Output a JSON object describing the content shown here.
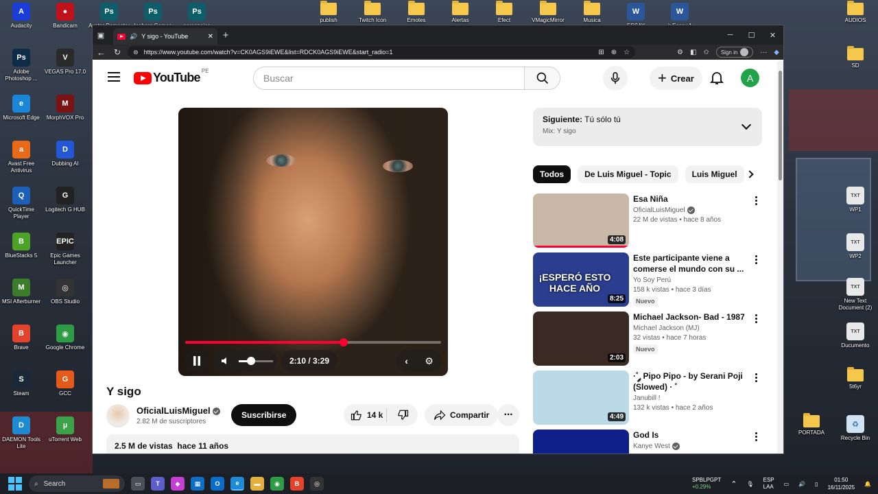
{
  "desktop": {
    "icons_left": [
      {
        "label": "Audacity",
        "color": "#1a3dd8",
        "glyph": "A"
      },
      {
        "label": "Bandicam",
        "color": "#c0121b",
        "glyph": "●"
      },
      {
        "label": "Avatar Remaster",
        "color": "#0d5e6a",
        "glyph": "Ps"
      },
      {
        "label": "Iceberg Games",
        "color": "#0d5e6a",
        "glyph": "Ps"
      },
      {
        "label": "personajes",
        "color": "#0d5e6a",
        "glyph": "Ps"
      },
      {
        "label": "Adobe Photoshop ...",
        "color": "#0e2b47",
        "glyph": "Ps"
      },
      {
        "label": "VEGAS Pro 17.0",
        "color": "#2a2a2a",
        "glyph": "V"
      },
      {
        "label": "Microsoft Edge",
        "color": "#1b86d6",
        "glyph": "e"
      },
      {
        "label": "MorphVOX Pro",
        "color": "#7a1414",
        "glyph": "M"
      },
      {
        "label": "Avast Free Antivirus",
        "color": "#e86a17",
        "glyph": "a"
      },
      {
        "label": "Dubbing AI",
        "color": "#2457d6",
        "glyph": "D"
      },
      {
        "label": "QuickTime Player",
        "color": "#1c5fb7",
        "glyph": "Q"
      },
      {
        "label": "Logitech G HUB",
        "color": "#222",
        "glyph": "G"
      },
      {
        "label": "BlueStacks 5",
        "color": "#4da327",
        "glyph": "B"
      },
      {
        "label": "Epic Games Launcher",
        "color": "#222",
        "glyph": "EPIC"
      },
      {
        "label": "MSI Afterburner",
        "color": "#3b7d2b",
        "glyph": "M"
      },
      {
        "label": "OBS Studio",
        "color": "#333",
        "glyph": "◎"
      },
      {
        "label": "Brave",
        "color": "#e2432a",
        "glyph": "B"
      },
      {
        "label": "Google Chrome",
        "color": "#2e9b45",
        "glyph": "◉"
      },
      {
        "label": "Steam",
        "color": "#1b2838",
        "glyph": "S"
      },
      {
        "label": "GCC",
        "color": "#e45a1a",
        "glyph": "G"
      },
      {
        "label": "DAEMON Tools Lite",
        "color": "#1d8bd1",
        "glyph": "D"
      },
      {
        "label": "uTorrent Web",
        "color": "#3aa34a",
        "glyph": "µ"
      }
    ],
    "icons_top": [
      {
        "label": "publish",
        "type": "folder"
      },
      {
        "label": "Twitch Icon",
        "type": "folder"
      },
      {
        "label": "Emotes",
        "type": "folder"
      },
      {
        "label": "Alertas",
        "type": "folder"
      },
      {
        "label": "Efect",
        "type": "folder"
      },
      {
        "label": "VMagicMirror",
        "type": "folder"
      },
      {
        "label": "Musica",
        "type": "folder"
      },
      {
        "label": "ESSAY",
        "type": "word"
      },
      {
        "label": "jr Essay 1",
        "type": "word"
      },
      {
        "label": "AUDIOS",
        "type": "folder"
      }
    ],
    "icons_right": [
      {
        "label": "SD",
        "type": "folder"
      },
      {
        "label": "WP1",
        "type": "txt"
      },
      {
        "label": "WP2",
        "type": "txt"
      },
      {
        "label": "New Text Document (2)",
        "type": "txt"
      },
      {
        "label": "Ducumento",
        "type": "txt"
      },
      {
        "label": "5t6yr",
        "type": "folder"
      },
      {
        "label": "PORTADA",
        "type": "folder"
      },
      {
        "label": "Recycle Bin",
        "type": "bin"
      }
    ]
  },
  "browser": {
    "tab_title": "Y sigo - YouTube",
    "url": "https://www.youtube.com/watch?v=CK0AGS9iEWE&list=RDCK0AGS9iEWE&start_radio=1",
    "signin_label": "Sign in"
  },
  "youtube": {
    "logo_word": "YouTube",
    "country_code": "PE",
    "search_placeholder": "Buscar",
    "create_label": "Crear",
    "avatar_letter": "A",
    "player": {
      "current_time": "2:10",
      "duration": "3:29",
      "time_display": "2:10 / 3:29",
      "progress_fraction": 0.62,
      "volume_fraction": 0.35
    },
    "video_title": "Y sigo",
    "channel": {
      "name": "OficialLuisMiguel",
      "subscribers": "2.82 M de suscriptores"
    },
    "subscribe_label": "Suscribirse",
    "likes": "14 k",
    "share_label": "Compartir",
    "description_summary": "2.5 M de vistas  hace 11 años",
    "up_next": {
      "prefix": "Siguiente:",
      "title": "Tú sólo tú",
      "subtitle": "Mix: Y sigo"
    },
    "chips": [
      "Todos",
      "De Luis Miguel - Topic",
      "Luis Miguel"
    ],
    "recommendations": [
      {
        "title": "Esa Niña",
        "channel": "OficialLuisMiguel",
        "verified": true,
        "meta": "22 M de vistas • hace 8 años",
        "duration": "4:08",
        "badge": "",
        "watched_fraction": 1.0,
        "thumb": "#c9b8a8"
      },
      {
        "title": "Este participante viene a comerse el mundo con su ...",
        "channel": "Yo Soy Perú",
        "verified": false,
        "meta": "158 k vistas • hace 3 días",
        "duration": "8:25",
        "badge": "Nuevo",
        "watched_fraction": 0,
        "thumb": "#2a3d8f"
      },
      {
        "title": "Michael Jackson- Bad - 1987",
        "channel": "Michael Jackson (MJ)",
        "verified": false,
        "meta": "32 vistas • hace 7 horas",
        "duration": "2:03",
        "badge": "Nuevo",
        "watched_fraction": 0,
        "thumb": "#3a2a24"
      },
      {
        "title": "·˚ ༘ Pipo Pipo - by Serani Poji (Slowed) · ˚",
        "channel": "Janubill !",
        "verified": false,
        "meta": "132 k vistas • hace 2 años",
        "duration": "4:49",
        "badge": "",
        "watched_fraction": 0,
        "thumb": "#bcd9e8"
      },
      {
        "title": "God Is",
        "channel": "Kanye West",
        "verified": true,
        "meta": "",
        "duration": "",
        "badge": "",
        "watched_fraction": 0,
        "thumb": "#10208a"
      }
    ],
    "thumb_text_2": "¡ESPERÓ ESTO HACE AÑO"
  },
  "taskbar": {
    "search_label": "Search",
    "weather_ticker": "SPBLPGPT",
    "weather_change": "+0.29%",
    "lang": "ESP",
    "lang2": "LAA",
    "time": "01:50",
    "date": "16/11/2025"
  }
}
